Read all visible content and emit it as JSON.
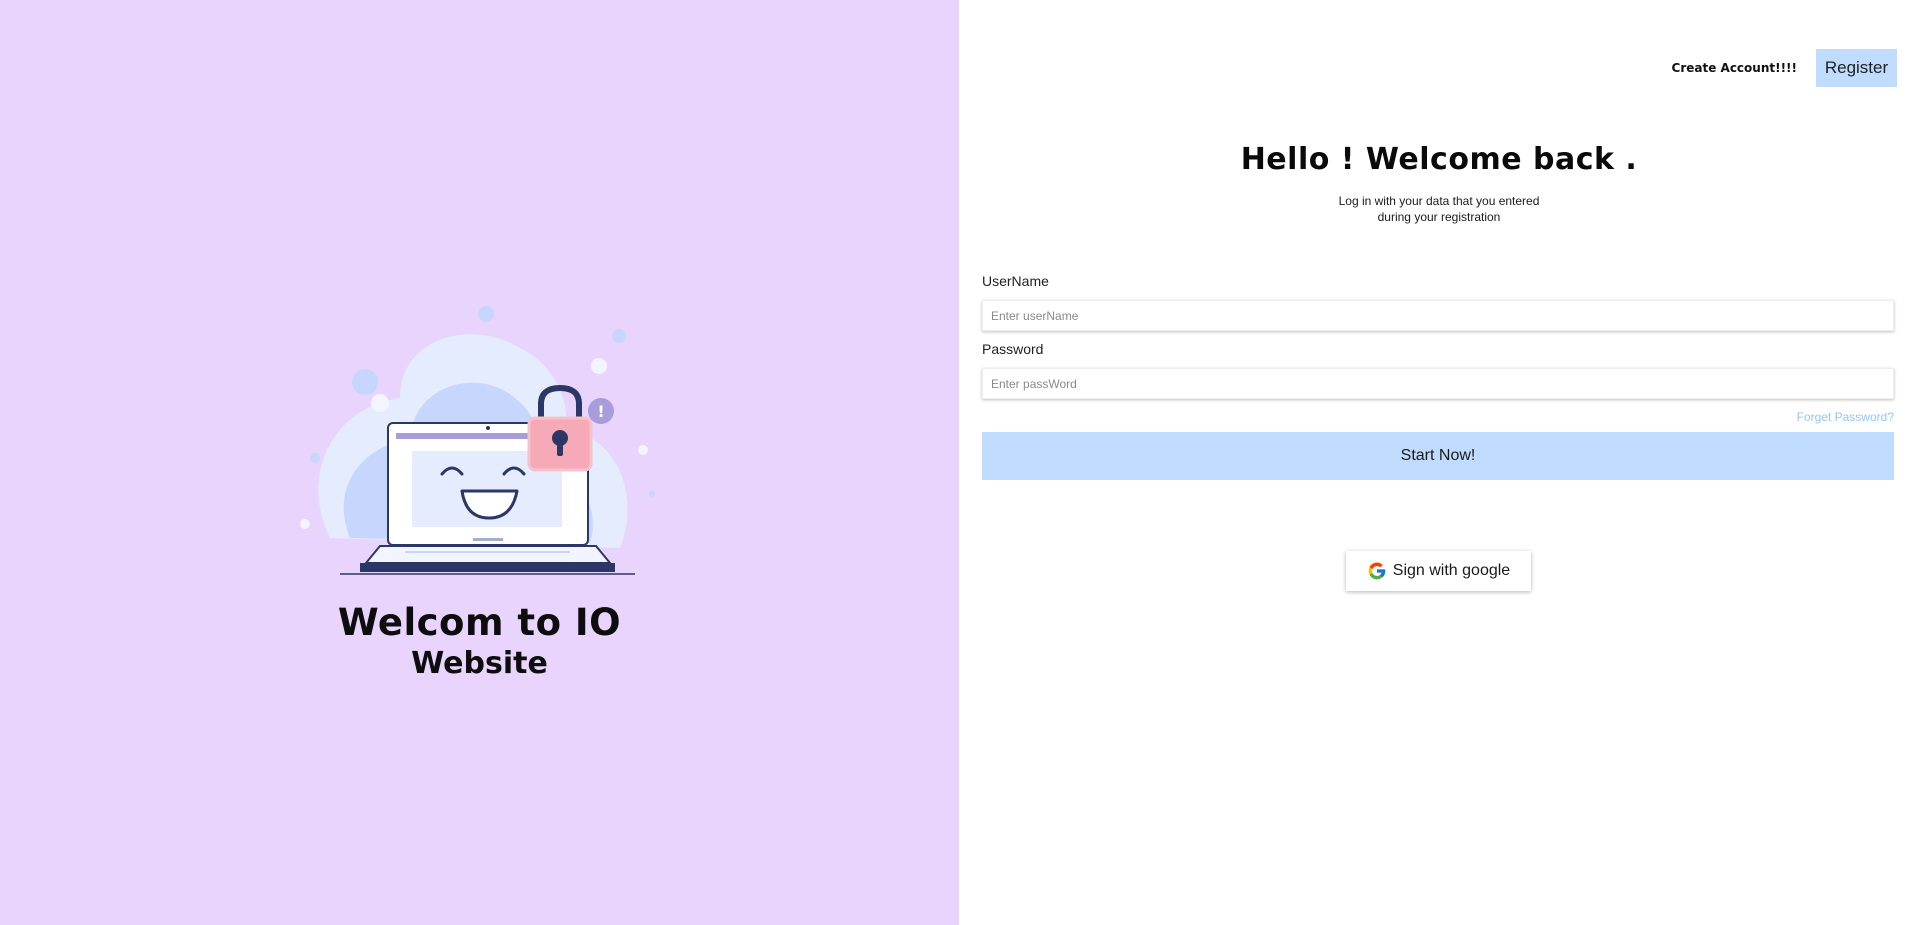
{
  "left_panel": {
    "title_line1": "Welcom to IO",
    "title_line2": "Website",
    "illustration": "laptop-smiley-with-padlock-illustration",
    "background_color": "#e9d4fe"
  },
  "header": {
    "create_account_label": "Create Account!!!!",
    "register_label": "Register"
  },
  "login": {
    "heading": "Hello ! Welcome back .",
    "subtext_line1": "Log in with your data that you entered",
    "subtext_line2": "during your registration",
    "username_label": "UserName",
    "username_placeholder": "Enter userName",
    "username_value": "",
    "password_label": "Password",
    "password_placeholder": "Enter passWord",
    "password_value": "",
    "forgot_label": "Forget Password?",
    "submit_label": "Start Now!",
    "google_label": "Sign with google"
  },
  "colors": {
    "accent": "#bfdbfe",
    "link": "#93c5fd",
    "left_bg": "#e9d4fe"
  },
  "icons": [
    "google-icon",
    "padlock-icon",
    "laptop-icon"
  ]
}
